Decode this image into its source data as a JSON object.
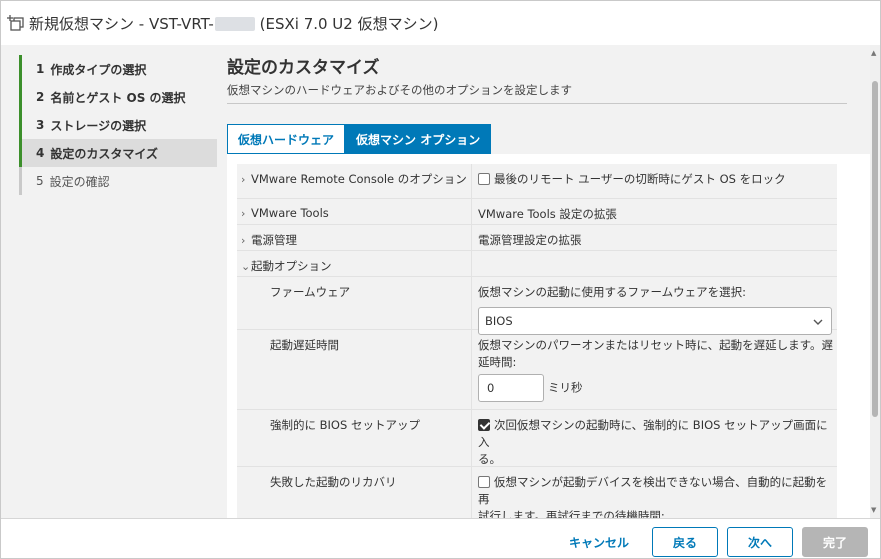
{
  "window": {
    "title_prefix": "新規仮想マシン - VST-VRT-",
    "title_suffix": "(ESXi 7.0 U2 仮想マシン)",
    "icon": "new-vm-icon"
  },
  "sidebar": {
    "steps": [
      {
        "num": "1",
        "label": "作成タイプの選択",
        "state": "done"
      },
      {
        "num": "2",
        "label": "名前とゲスト OS の選択",
        "state": "done"
      },
      {
        "num": "3",
        "label": "ストレージの選択",
        "state": "done"
      },
      {
        "num": "4",
        "label": "設定のカスタマイズ",
        "state": "active"
      },
      {
        "num": "5",
        "label": "設定の確認",
        "state": "pending"
      }
    ]
  },
  "main": {
    "title": "設定のカスタマイズ",
    "subtitle": "仮想マシンのハードウェアおよびその他のオプションを設定します",
    "tabs": [
      {
        "label": "仮想ハードウェア",
        "selected": false
      },
      {
        "label": "仮想マシン オプション",
        "selected": true
      }
    ],
    "options": {
      "vmrc": {
        "label": "VMware Remote Console のオプション",
        "checkbox_label": "最後のリモート ユーザーの切断時にゲスト OS をロック",
        "checked": false
      },
      "tools": {
        "label": "VMware Tools",
        "value": "VMware Tools 設定の拡張"
      },
      "power": {
        "label": "電源管理",
        "value": "電源管理設定の拡張"
      },
      "boot": {
        "label": "起動オプション",
        "firmware": {
          "label": "ファームウェア",
          "desc": "仮想マシンの起動に使用するファームウェアを選択:",
          "selected": "BIOS"
        },
        "delay": {
          "label": "起動遅延時間",
          "desc_line1": "仮想マシンのパワーオンまたはリセット時に、起動を遅延します。遅",
          "desc_line2": "延時間:",
          "value": "0",
          "unit": "ミリ秒"
        },
        "force_bios": {
          "label": "強制的に BIOS セットアップ",
          "checkbox_label_line1": "次回仮想マシンの起動時に、強制的に BIOS セットアップ画面に入",
          "checkbox_label_line2": "る。",
          "checked": true
        },
        "recovery": {
          "label": "失敗した起動のリカバリ",
          "checkbox_label_line1": "仮想マシンが起動デバイスを検出できない場合、自動的に起動を再",
          "checkbox_label_line2": "試行します。再試行までの待機時間:",
          "checked": false
        }
      }
    }
  },
  "footer": {
    "cancel": "キャンセル",
    "back": "戻る",
    "next": "次へ",
    "finish": "完了"
  },
  "colors": {
    "accent": "#0079b8",
    "done": "#3c8f2b",
    "disabled": "#b5b5b5"
  }
}
